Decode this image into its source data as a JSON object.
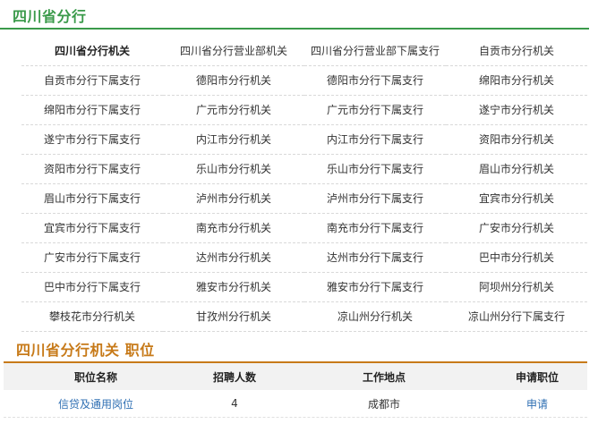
{
  "section1": {
    "title": "四川省分行",
    "units": [
      "四川省分行机关",
      "四川省分行营业部机关",
      "四川省分行营业部下属支行",
      "自贡市分行机关",
      "自贡市分行下属支行",
      "德阳市分行机关",
      "德阳市分行下属支行",
      "绵阳市分行机关",
      "绵阳市分行下属支行",
      "广元市分行机关",
      "广元市分行下属支行",
      "遂宁市分行机关",
      "遂宁市分行下属支行",
      "内江市分行机关",
      "内江市分行下属支行",
      "资阳市分行机关",
      "资阳市分行下属支行",
      "乐山市分行机关",
      "乐山市分行下属支行",
      "眉山市分行机关",
      "眉山市分行下属支行",
      "泸州市分行机关",
      "泸州市分行下属支行",
      "宜宾市分行机关",
      "宜宾市分行下属支行",
      "南充市分行机关",
      "南充市分行下属支行",
      "广安市分行机关",
      "广安市分行下属支行",
      "达州市分行机关",
      "达州市分行下属支行",
      "巴中市分行机关",
      "巴中市分行下属支行",
      "雅安市分行机关",
      "雅安市分行下属支行",
      "阿坝州分行机关",
      "攀枝花市分行机关",
      "甘孜州分行机关",
      "凉山州分行机关",
      "凉山州分行下属支行"
    ]
  },
  "section2": {
    "title": "四川省分行机关 职位",
    "headers": {
      "name": "职位名称",
      "count": "招聘人数",
      "location": "工作地点",
      "apply": "申请职位"
    },
    "rows": [
      {
        "name": "信贷及通用岗位",
        "count": "4",
        "location": "成都市",
        "apply": "申请"
      }
    ]
  }
}
